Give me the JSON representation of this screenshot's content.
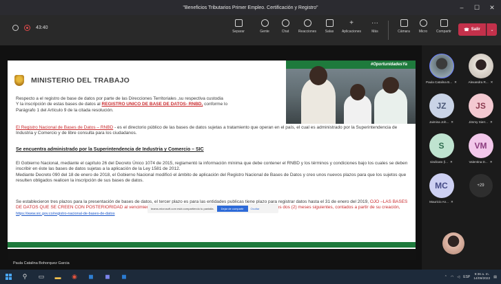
{
  "window": {
    "title": "\"Beneficios Tributarios Primer Empleo. Certificación y Registro\"",
    "minimize": "–",
    "maximize": "☐",
    "close": "✕"
  },
  "toolbar": {
    "timer": "43:40",
    "buttons": [
      {
        "label": "Separar",
        "icon": "separate-icon"
      },
      {
        "label": "Gente",
        "icon": "people-icon"
      },
      {
        "label": "Chat",
        "icon": "chat-icon"
      },
      {
        "label": "Reacciones",
        "icon": "reactions-icon"
      },
      {
        "label": "Salas",
        "icon": "rooms-icon"
      },
      {
        "label": "Aplicaciones",
        "icon": "apps-icon"
      },
      {
        "label": "Más",
        "icon": "more-icon"
      },
      {
        "label": "Cámara",
        "icon": "camera-icon"
      },
      {
        "label": "Micro",
        "icon": "mic-icon"
      },
      {
        "label": "Compartir",
        "icon": "share-icon"
      }
    ],
    "leave_label": "Salir",
    "leave_color": "#c4314b"
  },
  "slide": {
    "ministry": "MINISTERIO DEL TRABAJO",
    "banner": "#OportunidadesYa",
    "p1_a": "Respecto a el registro de base de datos por parte de las Direcciones Territoriales ,su respectiva custodia",
    "p1_b": "Y la inscripción de estas bases de datos al ",
    "p1_red": "REGISTRO UNICO DE BASE DE DATOS- RNBD,",
    "p1_c": " conforme lo",
    "p1_d": "Parágrafo 1 del Artículo 9 de la citada resolución.",
    "p2_red": "El Registro Nacional de Bases de Datos – RNBD",
    "p2_rest": " - es el directorio público de las bases de datos sujetas a tratamiento que operan en el país, el cual es administrado por la Superintendencia de Industria y Comercio y de libre consulta para los ciudadanos.",
    "heading": "Se encuentra administrado por la Superintendencia de Industria y Comercio – SIC",
    "p3": "El Gobierno Nacional, mediante el capítulo 26 del Decreto Único 1074 de 2015, reglamentó la información mínima que debe contener el RNBD y los términos y condiciones bajo los cuales se deben inscribir en éste las bases de datos sujetas a la aplicación de la Ley 1581 de 2012.",
    "p4": "Mediante Decreto 090 del 18 de enero de 2018, el Gobierno Nacional modificó el ámbito de aplicación del Registro Nacional de Bases de Datos y creo unos nuevos plazos para que los sujetos que resulten obligados realicen la inscripción de sus bases de datos.",
    "p5_a": "Se establecieron tres plazos para la presentación de bases de datos, el tercer plazo es para las entidades publicas tiene plazo para registrar datos hasta el 31 de enero del 2019, ",
    "p5_red": "OJO –LAS BASES DE DATOS QUE SE CREEN CON POSTERIORIDAD al vencimiento de los plazos ya mencionados, deberán inscribirse dentro de los dos (2) meses siguientes, contados a partir de su creación,",
    "p5_link": "https://www.sic.gov.co/registro-nacional-de-bases-de-datos",
    "brand_green": "#1e7a3c",
    "accent_red": "#c9292c"
  },
  "share_notice": {
    "text": "teams.microsoft.com está compartiendo tu pantalla.",
    "stop_label": "Dejar de compartir",
    "hide_label": "Ocultar"
  },
  "presenter": "Paula Catalina Bohorquez Garcia",
  "participants": [
    {
      "initials": "",
      "name": "Paula Catalina B...",
      "muted": true,
      "color": "#6c7b82"
    },
    {
      "initials": "",
      "name": "Alexandra R...",
      "muted": true,
      "color": "#cfc7be"
    },
    {
      "initials": "JZ",
      "name": "Jaimina Joh...",
      "muted": true,
      "color": "#c9d3e6"
    },
    {
      "initials": "JS",
      "name": "Jimmy Sierr...",
      "muted": true,
      "color": "#f3c9d1"
    },
    {
      "initials": "S",
      "name": "sindicato (l...",
      "muted": true,
      "color": "#bfe3d0"
    },
    {
      "initials": "VM",
      "name": "Valentina D...",
      "muted": true,
      "color": "#f2c7ea"
    },
    {
      "initials": "MC",
      "name": "Mauricio An...",
      "muted": true,
      "color": "#cdd0f2"
    }
  ],
  "more_participants": "+29",
  "taskbar": {
    "tray_lang": "ESP",
    "time": "9:36 a. m.",
    "date": "14/09/2022"
  }
}
